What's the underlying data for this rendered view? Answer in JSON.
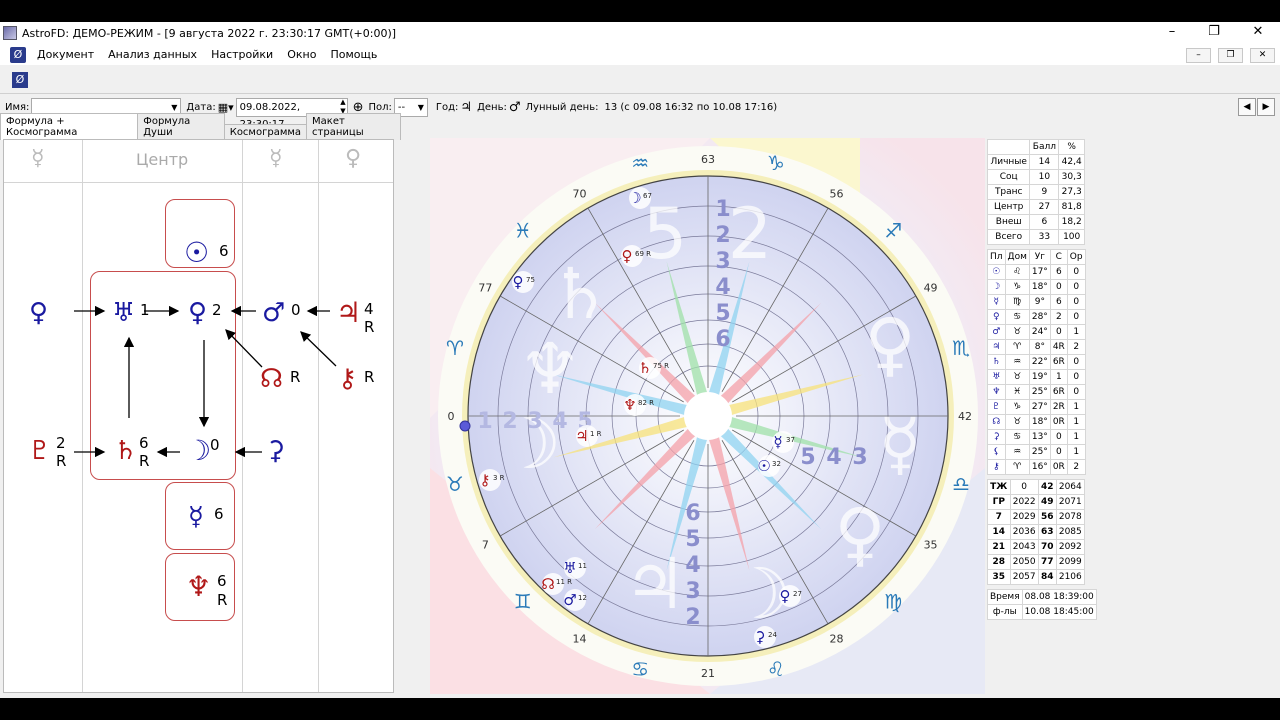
{
  "window": {
    "title": "AstroFD: ДЕМО-РЕЖИМ - [9 августа 2022 г. 23:30:17 GMT(+0:00)]",
    "controls": [
      "–",
      "❐",
      "✕"
    ],
    "mdi_controls": [
      "–",
      "❐",
      "✕"
    ]
  },
  "menu": [
    "Документ",
    "Анализ данных",
    "Настройки",
    "Окно",
    "Помощь"
  ],
  "fields": {
    "name_label": "Имя:",
    "name_value": "",
    "date_label": "Дата:",
    "date_value": "09.08.2022, 23:30:17",
    "sex_label": "Пол:",
    "sex_value": "--",
    "year_label": "Год:",
    "year_symbol": "♃",
    "day_label": "День:",
    "day_symbol": "♂",
    "lunar_label": "Лунный день:",
    "lunar_value": "13 (с 09.08 16:32 по 10.08 17:16)"
  },
  "tabs": [
    "Формула + Космограмма",
    "Формула Души",
    "Космограмма",
    "Макет страницы"
  ],
  "formula": {
    "header": [
      "☿",
      "Центр",
      "☿",
      "♀"
    ],
    "nodes": [
      {
        "id": "sun",
        "symbol": "☉",
        "sup": "6",
        "color": "#1a1aa0"
      },
      {
        "id": "venus-left",
        "symbol": "♀",
        "sup": "",
        "color": "#1a1aa0"
      },
      {
        "id": "uranus",
        "symbol": "♅",
        "sup": "1",
        "color": "#1a1aa0"
      },
      {
        "id": "venus",
        "symbol": "♀",
        "sup": "2",
        "color": "#1a1aa0"
      },
      {
        "id": "mars",
        "symbol": "♂",
        "sup": "0",
        "color": "#1a1aa0"
      },
      {
        "id": "jupiter",
        "symbol": "♃",
        "sup": "4",
        "sub": "R",
        "color": "#b01818"
      },
      {
        "id": "node",
        "symbol": "☊",
        "sup": "R",
        "color": "#b01818"
      },
      {
        "id": "chiron",
        "symbol": "⚷",
        "sup": "R",
        "color": "#b01818"
      },
      {
        "id": "pluto",
        "symbol": "♇",
        "sup": "2",
        "sub": "R",
        "color": "#b01818"
      },
      {
        "id": "saturn",
        "symbol": "♄",
        "sup": "6",
        "sub": "R",
        "color": "#b01818"
      },
      {
        "id": "moon",
        "symbol": "☽",
        "sup": "0",
        "color": "#1a1aa0"
      },
      {
        "id": "proserpina",
        "symbol": "⚳",
        "sup": "",
        "color": "#1a1aa0"
      },
      {
        "id": "mercury",
        "symbol": "☿",
        "sup": "6",
        "color": "#1a1aa0"
      },
      {
        "id": "neptune",
        "symbol": "♆",
        "sup": "6",
        "sub": "R",
        "color": "#b01818"
      }
    ]
  },
  "cosmogram": {
    "degree_marks": [
      "63",
      "56",
      "49",
      "42",
      "35",
      "28",
      "21",
      "14",
      "7",
      "0",
      "77",
      "70"
    ],
    "signs": [
      "♑",
      "♐",
      "♏",
      "♎",
      "♍",
      "♌",
      "♋",
      "♊",
      "♉",
      "♈",
      "♓",
      "♒"
    ],
    "house_numbers_top": [
      "1",
      "2",
      "3",
      "4",
      "5",
      "6"
    ],
    "house_numbers_left": [
      "1",
      "2",
      "3",
      "4",
      "5"
    ],
    "house_numbers_right": [
      "5",
      "4",
      "3"
    ],
    "house_numbers_bottom": [
      "6",
      "5",
      "4",
      "3",
      "2"
    ],
    "bg_glyphs": [
      "5",
      "2",
      "♄",
      "♆",
      "♀",
      "☽",
      "☿",
      "♃",
      "♀",
      "☽"
    ],
    "planets": [
      {
        "symbol": "☽",
        "label": "67"
      },
      {
        "symbol": "♀",
        "label": "69 R"
      },
      {
        "symbol": "♀",
        "label": "75"
      },
      {
        "symbol": "♄",
        "label": "75 R"
      },
      {
        "symbol": "♆",
        "label": "82 R"
      },
      {
        "symbol": "♃",
        "label": "1 R"
      },
      {
        "symbol": "⚷",
        "label": "3 R"
      },
      {
        "symbol": "♅",
        "label": "11"
      },
      {
        "symbol": "☊",
        "label": "11 R"
      },
      {
        "symbol": "♂",
        "label": "12"
      },
      {
        "symbol": "♀",
        "label": "27"
      },
      {
        "symbol": "⚳",
        "label": "24"
      },
      {
        "symbol": "☿",
        "label": "37"
      },
      {
        "symbol": "☉",
        "label": "32"
      }
    ]
  },
  "scores": {
    "header": [
      "",
      "Балл",
      "%"
    ],
    "rows": [
      [
        "Личные",
        "14",
        "42,4"
      ],
      [
        "Соц",
        "10",
        "30,3"
      ],
      [
        "Транс",
        "9",
        "27,3"
      ],
      [
        "Центр",
        "27",
        "81,8"
      ],
      [
        "Внеш",
        "6",
        "18,2"
      ],
      [
        "Всего",
        "33",
        "100"
      ]
    ]
  },
  "positions": {
    "header": [
      "Пл",
      "Дом",
      "Уг",
      "С",
      "Ор"
    ],
    "rows": [
      [
        "☉",
        "♌",
        "17°",
        "6",
        "0"
      ],
      [
        "☽",
        "♑",
        "18°",
        "0",
        "0"
      ],
      [
        "☿",
        "♍",
        "9°",
        "6",
        "0"
      ],
      [
        "♀",
        "♋",
        "28°",
        "2",
        "0"
      ],
      [
        "♂",
        "♉",
        "24°",
        "0",
        "1"
      ],
      [
        "♃",
        "♈",
        "8°",
        "4R",
        "2"
      ],
      [
        "♄",
        "♒",
        "22°",
        "6R",
        "0"
      ],
      [
        "♅",
        "♉",
        "19°",
        "1",
        "0"
      ],
      [
        "♆",
        "♓",
        "25°",
        "6R",
        "0"
      ],
      [
        "♇",
        "♑",
        "27°",
        "2R",
        "1"
      ],
      [
        "☊",
        "♉",
        "18°",
        "0R",
        "1"
      ],
      [
        "⚳",
        "♋",
        "13°",
        "0",
        "1"
      ],
      [
        "⚸",
        "♒",
        "25°",
        "0",
        "1"
      ],
      [
        "⚷",
        "♈",
        "16°",
        "0R",
        "2"
      ]
    ]
  },
  "cycles": {
    "rows": [
      [
        "ТЖ",
        "0",
        "42",
        "2064"
      ],
      [
        "ГР",
        "2022",
        "49",
        "2071"
      ],
      [
        "7",
        "2029",
        "56",
        "2078"
      ],
      [
        "14",
        "2036",
        "63",
        "2085"
      ],
      [
        "21",
        "2043",
        "70",
        "2092"
      ],
      [
        "28",
        "2050",
        "77",
        "2099"
      ],
      [
        "35",
        "2057",
        "84",
        "2106"
      ]
    ]
  },
  "time": {
    "rows": [
      [
        "Время",
        "08.08 18:39:00"
      ],
      [
        "ф-лы",
        "10.08 18:45:00"
      ]
    ]
  }
}
